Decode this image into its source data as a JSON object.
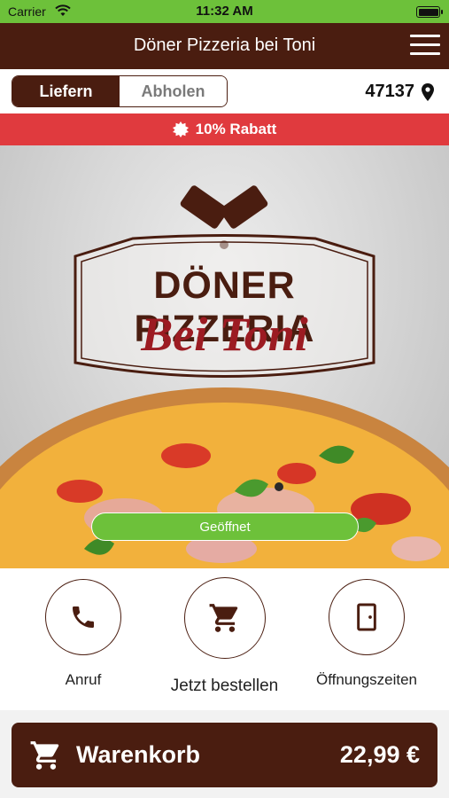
{
  "status_bar": {
    "carrier": "Carrier",
    "time": "11:32 AM"
  },
  "header": {
    "title": "Döner Pizzeria bei Toni"
  },
  "order_mode": {
    "deliver_label": "Liefern",
    "pickup_label": "Abholen",
    "selected": "Liefern",
    "zip_code": "47137"
  },
  "promo": {
    "text": "10% Rabatt"
  },
  "hero": {
    "logo_line1": "DÖNER PIZZERIA",
    "logo_line2": "Bei Toni",
    "status_label": "Geöffnet"
  },
  "actions": {
    "call_label": "Anruf",
    "order_label": "Jetzt bestellen",
    "hours_label": "Öffnungszeiten"
  },
  "cart": {
    "label": "Warenkorb",
    "total": "22,99 €"
  },
  "colors": {
    "brand_brown": "#4a1d10",
    "status_green": "#6dc13a",
    "promo_red": "#e03a3e",
    "logo_red": "#9c1b22"
  }
}
